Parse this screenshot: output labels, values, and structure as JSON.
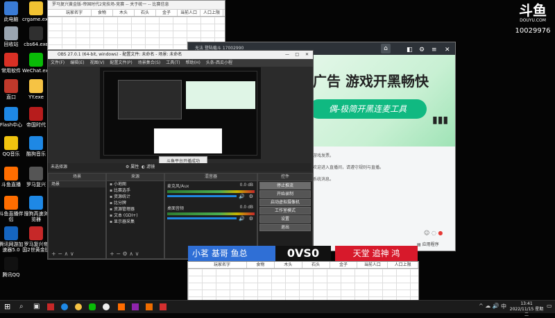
{
  "desktop_icons": [
    {
      "label": "此电脑",
      "color": "#3a7bd5"
    },
    {
      "label": "crgame.exe",
      "color": "#f1c232"
    },
    {
      "label": "回收站",
      "color": "#9aa5b1"
    },
    {
      "label": "cbs64.exe",
      "color": "#2f2f2f"
    },
    {
      "label": "常用软件",
      "color": "#d93025"
    },
    {
      "label": "WeChat.exe",
      "color": "#09bb07"
    },
    {
      "label": "直口",
      "color": "#c0392b"
    },
    {
      "label": "YY.exe",
      "color": "#f6c344"
    },
    {
      "label": "Flash中心",
      "color": "#1e88e5"
    },
    {
      "label": "帝国时代",
      "color": "#b71c1c"
    },
    {
      "label": "QQ音乐",
      "color": "#f1c40f"
    },
    {
      "label": "酷狗音乐",
      "color": "#1e88e5"
    },
    {
      "label": "斗鱼直播",
      "color": "#ff6d00"
    },
    {
      "label": "罗马复兴",
      "color": "#555555"
    },
    {
      "label": "斗鱼直播伴侣",
      "color": "#ff6d00"
    },
    {
      "label": "搜狗高速浏览器",
      "color": "#1e88e5"
    },
    {
      "label": "腾讯网游加速器5.0",
      "color": "#1565c0"
    },
    {
      "label": "罗马复兴帝国2世黄金版",
      "color": "#c62828"
    },
    {
      "label": "腾讯QQ",
      "color": "#111111"
    }
  ],
  "douyu": {
    "logo": "斗鱼",
    "domain": "DOUYU.COM",
    "room_id": "10029976"
  },
  "sheet_top": {
    "title": "罗马复兴黄金版-帝国时代2竞技场-竞赛 -- 关于统一 -- 比赛信息",
    "columns": [
      "玩家名字",
      "食物",
      "木头",
      "石头",
      "金子",
      "当前人口",
      "人口上限"
    ]
  },
  "sheet_bottom": {
    "columns": [
      "玩家名字",
      "食物",
      "木头",
      "石头",
      "金子",
      "当前人口",
      "人口上限"
    ]
  },
  "obs": {
    "title": "OBS 27.0.1 (64-bit, windows) - 配置文件: 未命名 - 场景: 未命名",
    "menu": [
      "文件(F)",
      "编辑(E)",
      "视图(V)",
      "配置文件(P)",
      "场景集合(S)",
      "工具(T)",
      "帮助(H)",
      "头条-西瓜小程"
    ],
    "scene_panel": "场景",
    "scene_item": "场景",
    "sources_panel": "来源",
    "sources": [
      "小地图",
      "比赛选手",
      "资源统计",
      "比分牌",
      "资源管理器",
      "文本 (GDI+)",
      "显示器采集"
    ],
    "mixer_panel": "混音器",
    "mixer_tracks": [
      {
        "name": "麦克风/Aux",
        "db": "0.0 dB"
      },
      {
        "name": "桌面音频",
        "db": "0.0 dB"
      }
    ],
    "controls_panel": "控件",
    "controls": [
      "停止推流",
      "开始录制",
      "启动虚拟摄像机",
      "工作室模式",
      "设置",
      "退出"
    ],
    "status_left": "未选择源",
    "status_props": "属性",
    "status_filters": "滤镜",
    "toast": "斗鱼平台开播成功"
  },
  "ad_window": {
    "toolbar_text": "无法  登陆载斗  17002990",
    "headline": "广告 游戏开黑畅快",
    "slogan": "偶-极简开黑连麦工具",
    "chat_lines": [
      "游戏发票。",
      "欢迎进入直播间，请遵守规则与直播。",
      "系统消息。"
    ],
    "footer": "应用程序"
  },
  "vs_banner": {
    "left_team": "小茗 基哥 鱼总",
    "score_left": "0",
    "vs": "VS",
    "score_right": "0",
    "right_team": "天堂 追神 鸿"
  },
  "taskbar": {
    "time": "13:41",
    "date": "2022/11/15 星期二",
    "ime": "中"
  }
}
